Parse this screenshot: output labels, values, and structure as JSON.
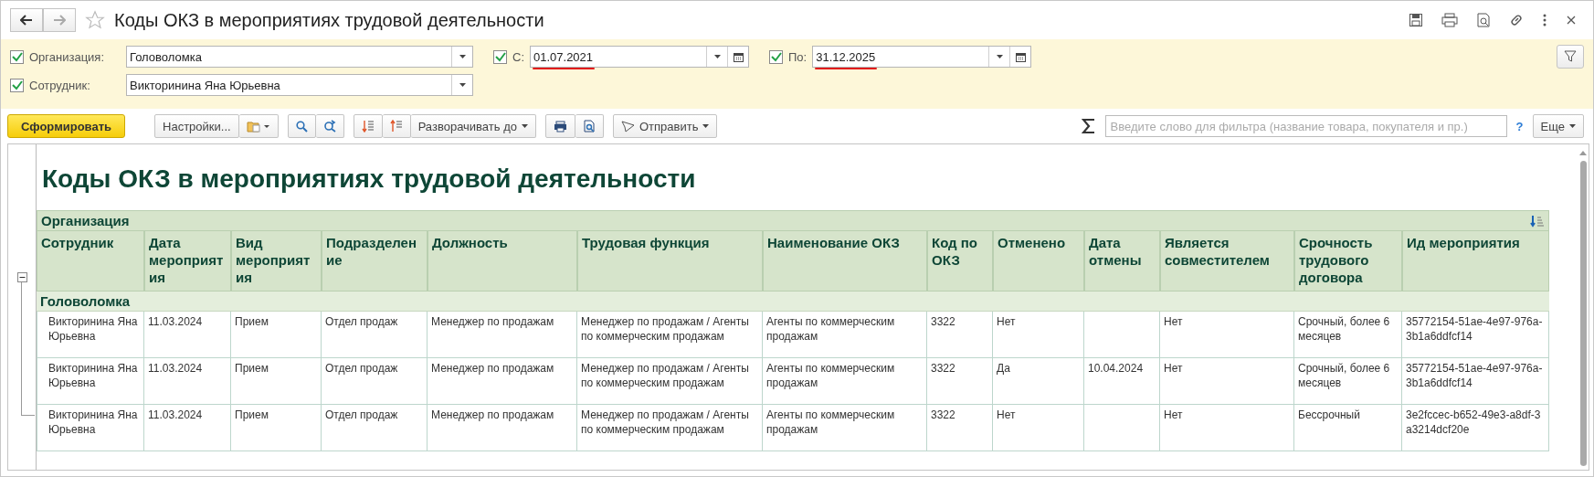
{
  "window": {
    "title": "Коды ОКЗ в мероприятиях трудовой деятельности"
  },
  "filters": [
    {
      "label": "Организация:",
      "value": "Головоломка",
      "checked": true,
      "kind": "select"
    },
    {
      "label": "С:",
      "value": "01.07.2021",
      "checked": true,
      "kind": "date"
    },
    {
      "label": "По:",
      "value": "31.12.2025",
      "checked": true,
      "kind": "date"
    },
    {
      "label": "Сотрудник:",
      "value": "Викторинина Яна Юрьевна",
      "checked": true,
      "kind": "select"
    }
  ],
  "toolbar": {
    "generate": "Сформировать",
    "settings": "Настройки...",
    "expand": "Разворачивать до",
    "send": "Отправить",
    "search": {
      "placeholder": "Введите слово для фильтра (название товара, покупателя и пр.)"
    },
    "help": "?",
    "more": "Еще"
  },
  "report": {
    "title": "Коды ОКЗ в мероприятиях трудовой деятельности",
    "group_header": "Организация",
    "columns": [
      "Сотрудник",
      "Дата мероприятия",
      "Вид мероприятия",
      "Подразделение",
      "Должность",
      "Трудовая функция",
      "Наименование ОКЗ",
      "Код по ОКЗ",
      "Отменено",
      "Дата отмены",
      "Является совместителем",
      "Срочность трудового договора",
      "Ид мероприятия"
    ],
    "groups": [
      {
        "name": "Головоломка",
        "expanded": true,
        "rows": [
          [
            "Викторинина Яна Юрьевна",
            "11.03.2024",
            "Прием",
            "Отдел продаж",
            "Менеджер по продажам",
            "Менеджер по продажам / Агенты по коммерческим продажам",
            "Агенты по коммерческим продажам",
            "3322",
            "Нет",
            "",
            "Нет",
            "Срочный, более 6 месяцев",
            "35772154-51ae-4e97-976a-3b1a6ddfcf14"
          ],
          [
            "Викторинина Яна Юрьевна",
            "11.03.2024",
            "Прием",
            "Отдел продаж",
            "Менеджер по продажам",
            "Менеджер по продажам / Агенты по коммерческим продажам",
            "Агенты по коммерческим продажам",
            "3322",
            "Да",
            "10.04.2024",
            "Нет",
            "Срочный, более 6 месяцев",
            "35772154-51ae-4e97-976a-3b1a6ddfcf14"
          ],
          [
            "Викторинина Яна Юрьевна",
            "11.03.2024",
            "Прием",
            "Отдел продаж",
            "Менеджер по продажам",
            "Менеджер по продажам / Агенты по коммерческим продажам",
            "Агенты по коммерческим продажам",
            "3322",
            "Нет",
            "",
            "Нет",
            "Бессрочный",
            "3e2fccec-b652-49e3-a8df-3a3214dcf20e"
          ]
        ]
      }
    ]
  }
}
